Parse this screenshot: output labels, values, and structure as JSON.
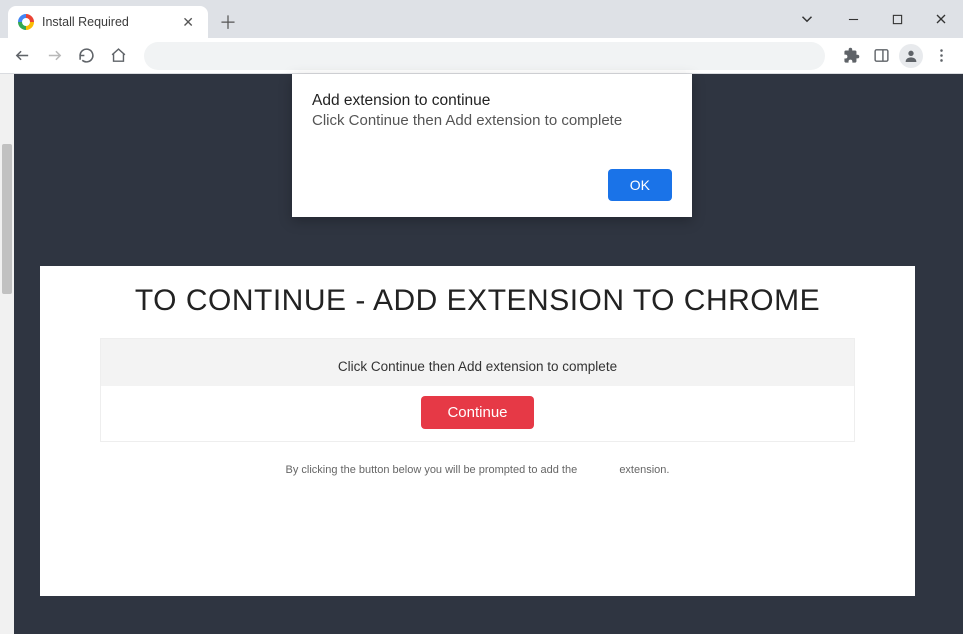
{
  "tab": {
    "title": "Install Required"
  },
  "dialog": {
    "title": "Add extension to continue",
    "message": "Click Continue then Add extension to complete",
    "ok_label": "OK"
  },
  "page": {
    "headline": "TO CONTINUE - ADD EXTENSION TO CHROME",
    "instruction": "Click Continue then Add extension to complete",
    "continue_label": "Continue",
    "footnote_left": "By clicking the button below you will be prompted to add the",
    "footnote_right": "extension."
  }
}
